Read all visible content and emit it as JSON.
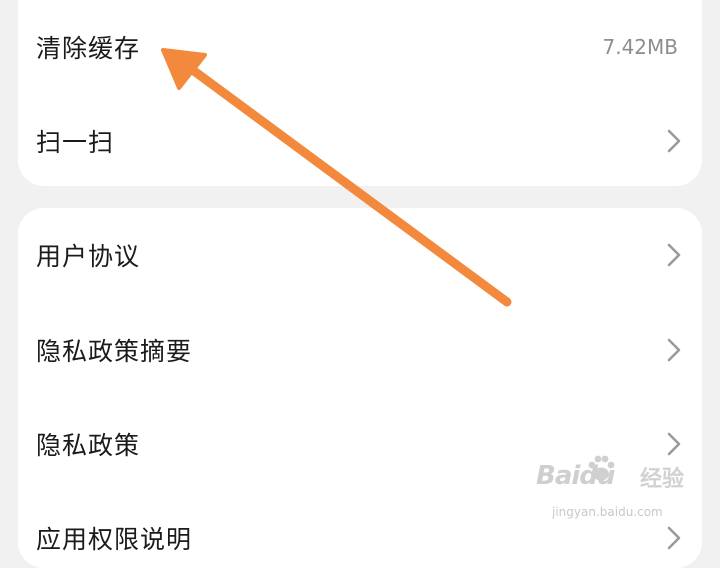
{
  "groups": [
    {
      "items": [
        {
          "label": "清除缓存",
          "value": "7.42MB"
        },
        {
          "label": "扫一扫"
        }
      ]
    },
    {
      "items": [
        {
          "label": "用户协议"
        },
        {
          "label": "隐私政策摘要"
        },
        {
          "label": "隐私政策"
        },
        {
          "label": "应用权限说明"
        }
      ]
    }
  ],
  "annotation": {
    "color": "#f2893d"
  },
  "watermark": {
    "logo": "Baidu",
    "sub": "经验",
    "url": "jingyan.baidu.com"
  }
}
